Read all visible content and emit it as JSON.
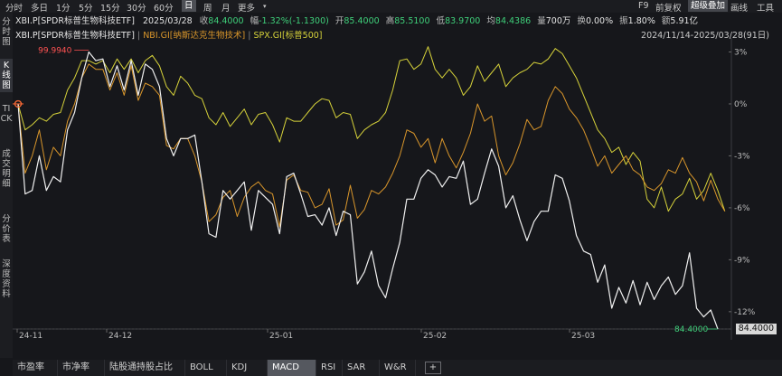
{
  "toolbar": {
    "intervals": [
      "分时",
      "多日",
      "1分",
      "5分",
      "15分",
      "30分",
      "60分",
      "日",
      "周",
      "月",
      "更多"
    ],
    "selected": "日",
    "right_items": [
      "F9",
      "前复权",
      "超级叠加",
      "画线",
      "工具"
    ],
    "highlighted": "超级叠加",
    "arrow_icon": "chevron-down-icon"
  },
  "info": {
    "name": "XBI.P[SPDR标普生物科技ETF]",
    "date": "2025/03/28",
    "close_label": "收",
    "close": "84.4000",
    "chg_label": "幅",
    "chg": "-1.32%(-1.1300)",
    "open_label": "开",
    "open": "85.4000",
    "high_label": "高",
    "high": "85.5100",
    "low_label": "低",
    "low": "83.9700",
    "avg_label": "均",
    "avg": "84.4386",
    "vol_label": "量",
    "vol": "700万",
    "turn_label": "换",
    "turn": "0.00%",
    "amp_label": "振",
    "amp": "1.80%",
    "amt_label": "额",
    "amt": "5.91亿"
  },
  "legend": {
    "items": [
      {
        "text": "XBI.P[SPDR标普生物科技ETF]",
        "color": "#e8e8e8"
      },
      {
        "text": "NBI.GI[纳斯达克生物技术]",
        "color": "#d9962b"
      },
      {
        "text": "SPX.GI[标普500]",
        "color": "#d6d23a"
      }
    ],
    "separator": "|",
    "range": "2024/11/14-2025/03/28(91日)"
  },
  "sidebar": {
    "items": [
      {
        "text": "分时图",
        "active": false
      },
      {
        "text": "K线图",
        "active": true
      },
      {
        "text": "TICK",
        "active": false
      },
      {
        "text": "成交明细",
        "active": false
      },
      {
        "text": "分价表",
        "active": false
      },
      {
        "text": "深度资料",
        "active": false
      }
    ]
  },
  "chart_data": {
    "type": "line",
    "x_ticks": [
      "24-11",
      "24-12",
      "25-01",
      "25-02",
      "25-03"
    ],
    "y_ticks": [
      "3%",
      "0%",
      "-3%",
      "-6%",
      "-9%",
      "-12%"
    ],
    "ylim": [
      -13,
      3.6
    ],
    "max_label": "99.9940",
    "last_label": "84.4000",
    "price_tag": "84.4000",
    "series": [
      {
        "name": "XBI.P[SPDR标普生物科技ETF]",
        "color": "#f0f0f0",
        "values": [
          0,
          -5.2,
          -5.0,
          -3.0,
          -5.0,
          -4.2,
          -4.5,
          -1.5,
          -0.5,
          1.5,
          3.0,
          2.5,
          2.6,
          1.0,
          2.2,
          0.8,
          2.5,
          0.5,
          2.3,
          2.0,
          1.0,
          -2.0,
          -3.0,
          -2.0,
          -2.0,
          -1.8,
          -4.5,
          -7.5,
          -7.7,
          -5.0,
          -5.5,
          -5.0,
          -4.5,
          -7.3,
          -5.0,
          -5.4,
          -5.8,
          -7.5,
          -4.2,
          -4.0,
          -5.2,
          -6.5,
          -6.4,
          -7.0,
          -6.0,
          -7.6,
          -6.2,
          -6.4,
          -10.4,
          -9.7,
          -8.5,
          -10.5,
          -11.2,
          -9.5,
          -8.0,
          -5.5,
          -5.5,
          -4.3,
          -3.8,
          -4.1,
          -4.8,
          -4.2,
          -4.3,
          -3.3,
          -5.8,
          -5.5,
          -4.0,
          -2.6,
          -3.6,
          -6.0,
          -5.3,
          -6.7,
          -7.9,
          -6.8,
          -6.2,
          -6.2,
          -4.1,
          -4.3,
          -5.6,
          -7.6,
          -8.5,
          -8.7,
          -10.3,
          -9.3,
          -11.8,
          -10.6,
          -11.5,
          -10.2,
          -11.6,
          -10.3,
          -11.3,
          -10.5,
          -10.0,
          -11.0,
          -10.5,
          -8.6,
          -11.8,
          -12.3,
          -11.9,
          -13.0
        ]
      },
      {
        "name": "NBI.GI[纳斯达克生物技术]",
        "color": "#d9962b",
        "values": [
          0,
          -4.0,
          -3.0,
          -1.5,
          -3.8,
          -2.5,
          -3.0,
          -1.0,
          0,
          1.5,
          2.3,
          2.0,
          2.0,
          0.8,
          1.8,
          0.5,
          2.2,
          0.2,
          1.2,
          1.0,
          0.5,
          -2.4,
          -2.6,
          -2.0,
          -2.0,
          -3.0,
          -4.5,
          -6.8,
          -6.4,
          -5.4,
          -5.0,
          -6.5,
          -5.4,
          -4.8,
          -4.5,
          -5.0,
          -5.2,
          -7.1,
          -4.4,
          -4.1,
          -5.0,
          -5.1,
          -6.0,
          -5.8,
          -4.9,
          -7.0,
          -6.7,
          -4.7,
          -6.6,
          -6.1,
          -5.0,
          -5.2,
          -4.8,
          -4.0,
          -3.0,
          -1.5,
          -1.7,
          -2.5,
          -2.0,
          -3.4,
          -2.0,
          -3.0,
          -3.7,
          -2.8,
          -1.7,
          0,
          -1.0,
          -0.7,
          -3.0,
          -4.1,
          -3.4,
          -2.3,
          -0.9,
          -1.5,
          -1.3,
          0.2,
          1.0,
          0.6,
          -0.3,
          -0.8,
          -1.5,
          -2.5,
          -3.6,
          -3.0,
          -4.0,
          -3.5,
          -3.0,
          -3.8,
          -4.1,
          -4.8,
          -5.0,
          -4.6,
          -3.8,
          -4.0,
          -3.1,
          -4.0,
          -4.5,
          -5.6,
          -4.4,
          -5.5,
          -6.2
        ]
      },
      {
        "name": "SPX.GI[标普500]",
        "color": "#d6d23a",
        "values": [
          0,
          -1.5,
          -1.2,
          -0.8,
          -1.0,
          -0.6,
          -0.5,
          0.8,
          1.5,
          2.5,
          2.5,
          2.3,
          2.5,
          1.8,
          2.6,
          2.0,
          2.6,
          1.8,
          2.5,
          2.8,
          2.2,
          1.0,
          0.5,
          1.6,
          1.2,
          0.5,
          0.3,
          -0.8,
          -1.2,
          -0.5,
          -1.3,
          -0.8,
          -0.3,
          -1.2,
          -0.6,
          -0.5,
          -1.2,
          -2.2,
          -0.8,
          -1.0,
          -1.0,
          -0.5,
          0,
          0.3,
          0.2,
          -0.8,
          -0.5,
          -0.6,
          -2.0,
          -1.5,
          -1.2,
          -1.0,
          -0.5,
          0.8,
          2.5,
          2.6,
          2.0,
          2.3,
          3.3,
          2.0,
          1.5,
          2.0,
          1.5,
          0.5,
          1.0,
          2.2,
          1.3,
          1.8,
          2.3,
          1.0,
          1.5,
          1.8,
          2.0,
          2.4,
          2.3,
          2.6,
          3.2,
          2.9,
          2.2,
          1.5,
          0.5,
          -0.5,
          -1.5,
          -2.0,
          -2.8,
          -2.5,
          -3.5,
          -2.8,
          -3.3,
          -5.5,
          -6.0,
          -4.8,
          -6.2,
          -5.5,
          -5.2,
          -4.3,
          -5.5,
          -5.0,
          -4.0,
          -5.0,
          -6.2
        ]
      }
    ]
  },
  "tabs": {
    "items": [
      "市盈率",
      "市净率",
      "陆股通持股占比",
      "BOLL",
      "KDJ",
      "MACD",
      "RSI",
      "SAR",
      "W&R"
    ],
    "active": "MACD",
    "add_icon": "plus-icon"
  }
}
